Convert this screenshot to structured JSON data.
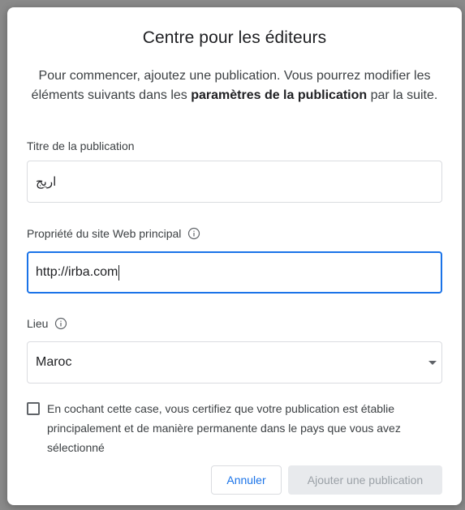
{
  "dialog": {
    "title": "Centre pour les éditeurs",
    "intro_part1": "Pour commencer, ajoutez une publication. Vous pourrez modifier les éléments suivants dans les ",
    "intro_bold": "paramètres de la publication",
    "intro_part2": " par la suite."
  },
  "form": {
    "title_label": "Titre de la publication",
    "title_value": "اريج",
    "website_label": "Propriété du site Web principal",
    "website_value": "http://irba.com",
    "location_label": "Lieu",
    "location_value": "Maroc",
    "checkbox_label": "En cochant cette case, vous certifiez que votre publication est établie principalement et de manière permanente dans le pays que vous avez sélectionné",
    "checkbox_checked": false
  },
  "actions": {
    "cancel_label": "Annuler",
    "add_label": "Ajouter une publication"
  },
  "icons": {
    "info": "info-icon",
    "dropdown": "chevron-down-icon"
  },
  "colors": {
    "accent": "#1a73e8",
    "disabled_bg": "#e8eaed",
    "disabled_text": "#9aa0a6"
  }
}
